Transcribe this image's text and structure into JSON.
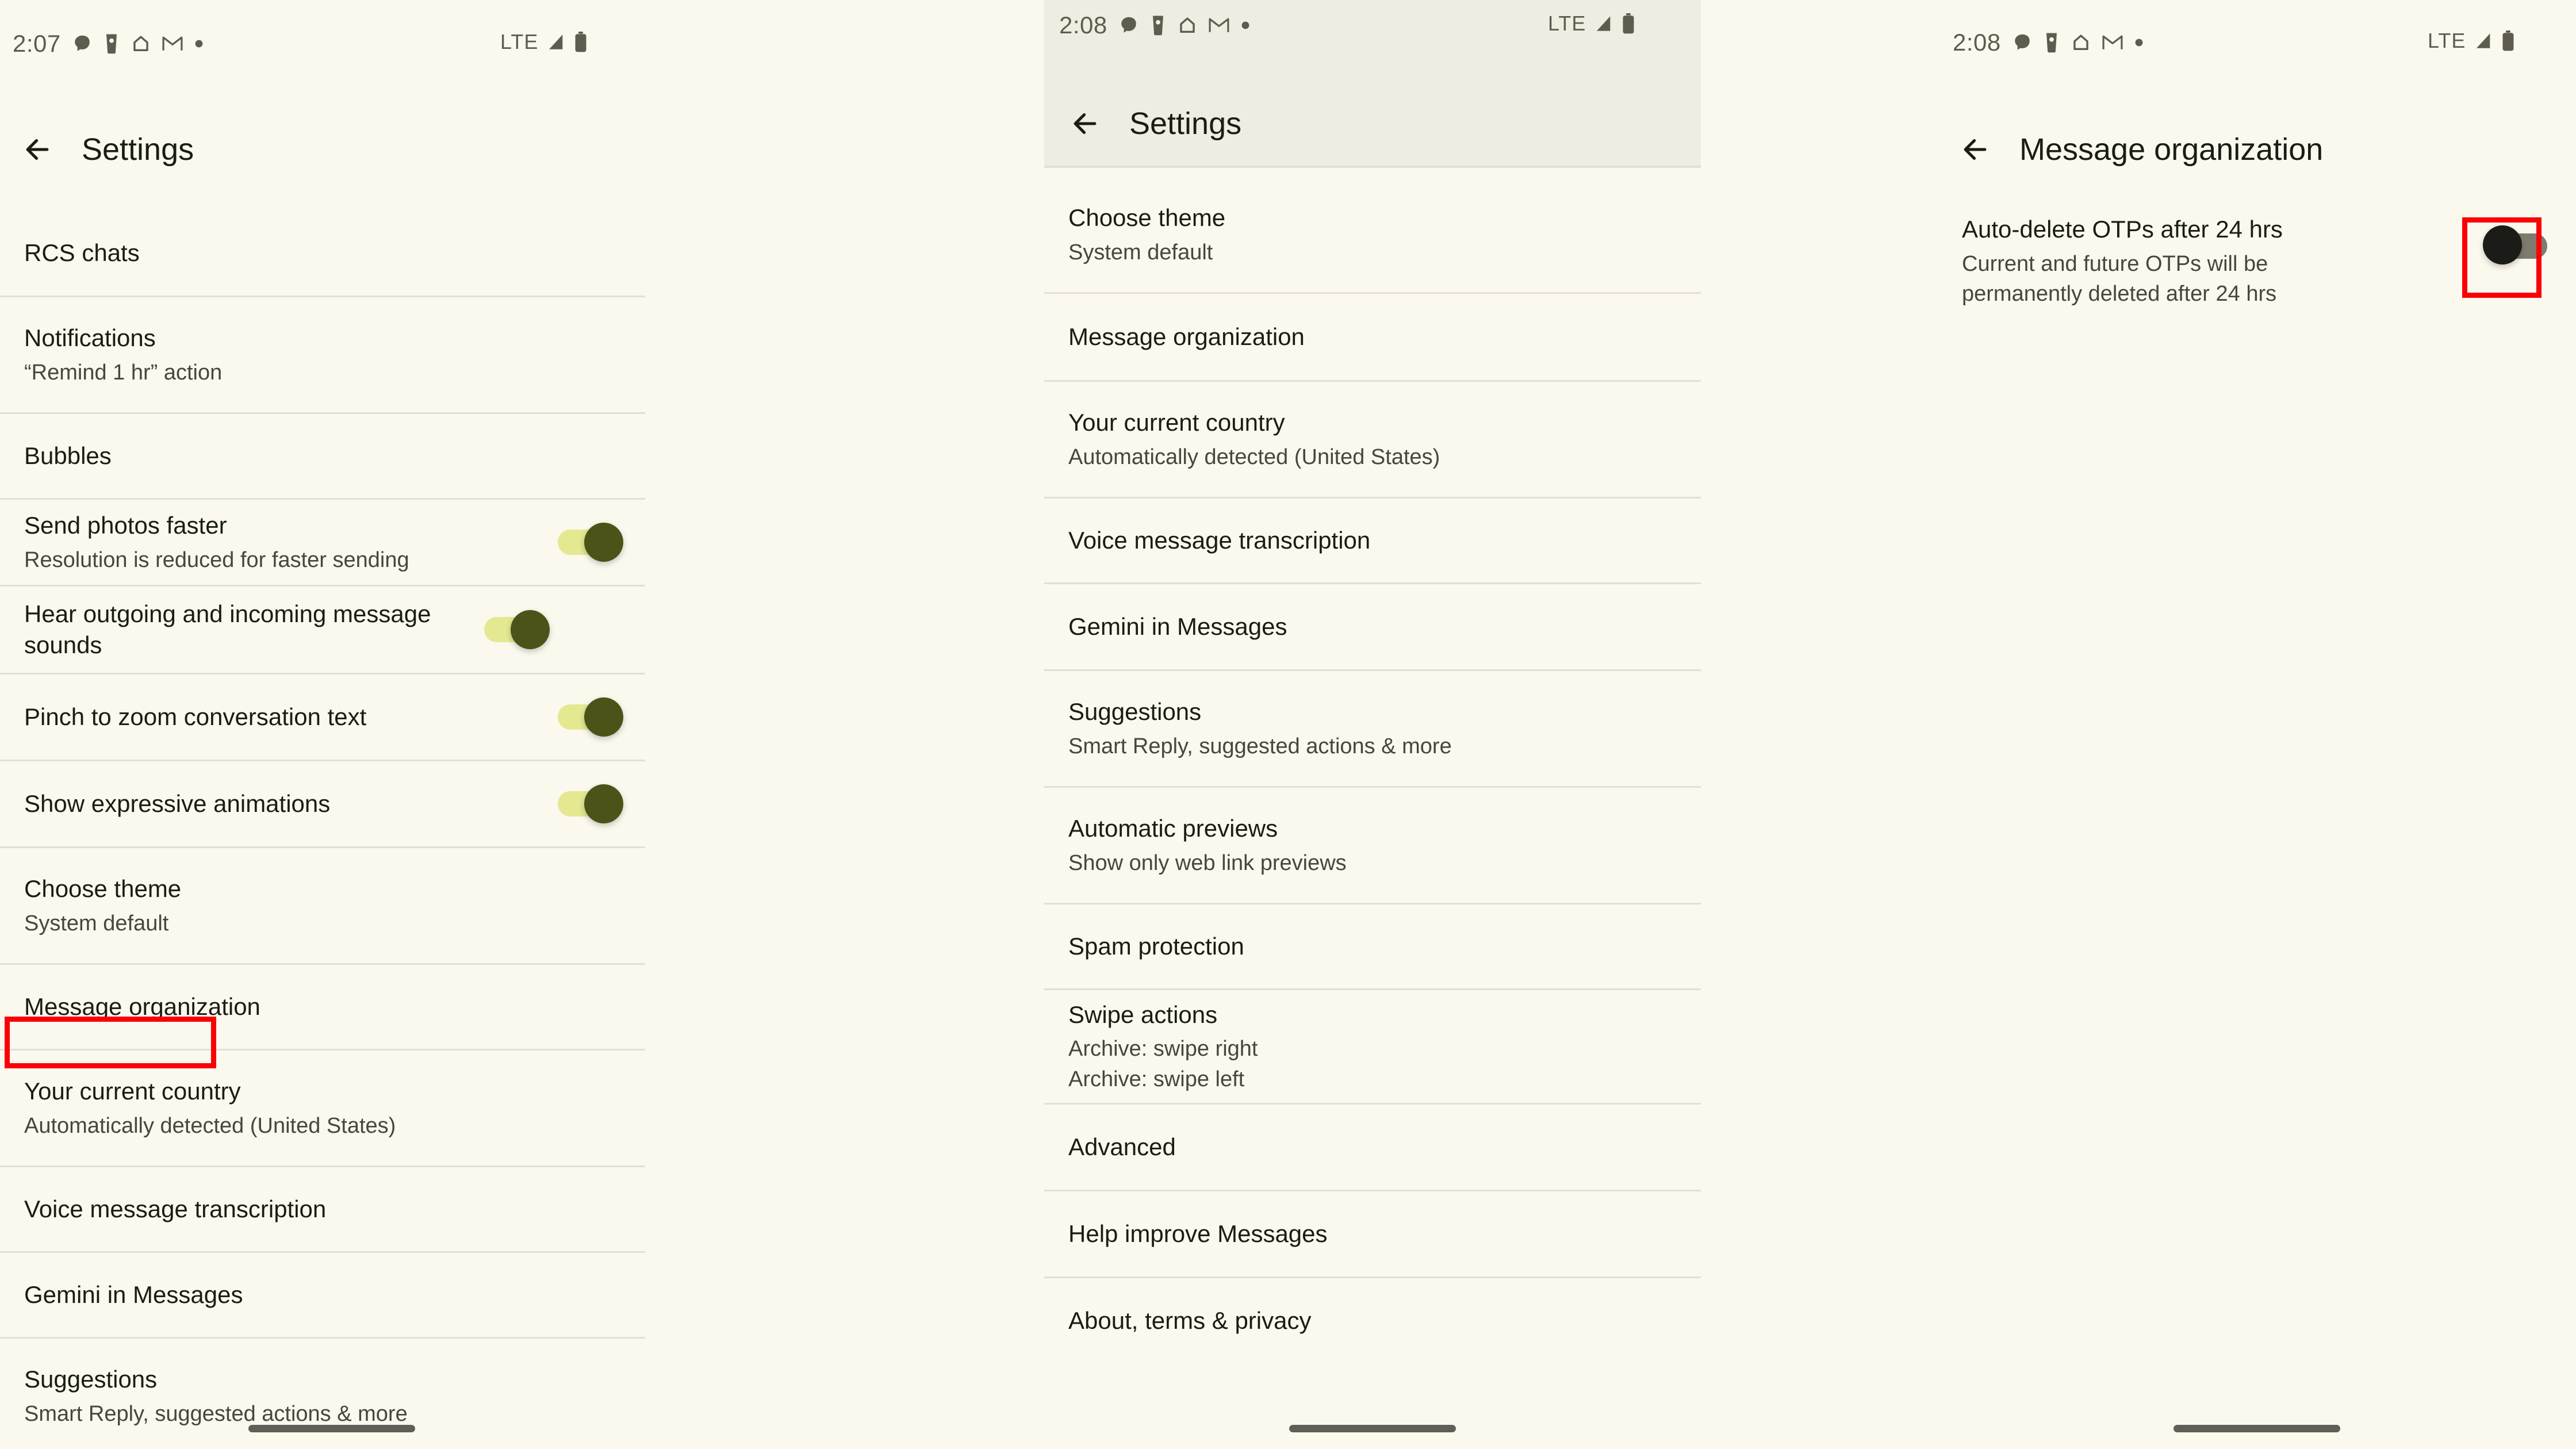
{
  "colors": {
    "background": "#FBF8EE",
    "scrolled_header": "#EFEDE1",
    "divider": "#E2E0D3",
    "title_text": "#191D13",
    "sub_text": "#45483C",
    "status_text": "#5E5B4F",
    "highlight_box": "#FB0006",
    "toggle_on_track": "#E4E891",
    "toggle_on_thumb": "#4B5318",
    "toggle_off_track": "#7E7C6E",
    "toggle_off_thumb": "#1B1B17",
    "gesture_bar": "#605E57"
  },
  "panel_1": {
    "status_bar": {
      "time": "2:07",
      "network": "LTE",
      "icons": [
        "chat-bubble-icon",
        "coffee-cup-icon",
        "home-icon",
        "gmail-icon",
        "dot-icon"
      ],
      "right_icons": [
        "signal-icon",
        "battery-icon"
      ]
    },
    "app_bar": {
      "back": "back-arrow-icon",
      "title": "Settings"
    },
    "rows": [
      {
        "title": "RCS chats",
        "sub": "",
        "toggle": null
      },
      {
        "title": "Notifications",
        "sub": "“Remind 1 hr” action",
        "toggle": null
      },
      {
        "title": "Bubbles",
        "sub": "",
        "toggle": null
      },
      {
        "title": "Send photos faster",
        "sub": "Resolution is reduced for faster sending",
        "toggle": "on"
      },
      {
        "title": "Hear outgoing and incoming message sounds",
        "sub": "",
        "toggle": "on"
      },
      {
        "title": "Pinch to zoom conversation text",
        "sub": "",
        "toggle": "on"
      },
      {
        "title": "Show expressive animations",
        "sub": "",
        "toggle": "on"
      },
      {
        "title": "Choose theme",
        "sub": "System default",
        "toggle": null
      },
      {
        "title": "Message organization",
        "sub": "",
        "toggle": null
      },
      {
        "title": "Your current country",
        "sub": "Automatically detected (United States)",
        "toggle": null
      },
      {
        "title": "Voice message transcription",
        "sub": "",
        "toggle": null
      },
      {
        "title": "Gemini in Messages",
        "sub": "",
        "toggle": null
      },
      {
        "title": "Suggestions",
        "sub": "Smart Reply, suggested actions & more",
        "toggle": null
      }
    ],
    "highlight_target": "Message organization"
  },
  "panel_2": {
    "status_bar": {
      "time": "2:08",
      "network": "LTE",
      "icons": [
        "chat-bubble-icon",
        "coffee-cup-icon",
        "home-icon",
        "gmail-icon",
        "dot-icon"
      ],
      "right_icons": [
        "signal-icon",
        "battery-icon"
      ]
    },
    "app_bar": {
      "back": "back-arrow-icon",
      "title": "Settings"
    },
    "rows": [
      {
        "title": "Choose theme",
        "sub": "System default"
      },
      {
        "title": "Message organization",
        "sub": ""
      },
      {
        "title": "Your current country",
        "sub": "Automatically detected (United States)"
      },
      {
        "title": "Voice message transcription",
        "sub": ""
      },
      {
        "title": "Gemini in Messages",
        "sub": ""
      },
      {
        "title": "Suggestions",
        "sub": "Smart Reply, suggested actions & more"
      },
      {
        "title": "Automatic previews",
        "sub": "Show only web link previews"
      },
      {
        "title": "Spam protection",
        "sub": ""
      },
      {
        "title": "Swipe actions",
        "sub": "Archive: swipe right",
        "sub2": "Archive: swipe left"
      },
      {
        "title": "Advanced",
        "sub": ""
      },
      {
        "title": "Help improve Messages",
        "sub": ""
      },
      {
        "title": "About, terms & privacy",
        "sub": ""
      }
    ]
  },
  "panel_3": {
    "status_bar": {
      "time": "2:08",
      "network": "LTE",
      "icons": [
        "chat-bubble-icon",
        "coffee-cup-icon",
        "home-icon",
        "gmail-icon",
        "dot-icon"
      ],
      "right_icons": [
        "signal-icon",
        "battery-icon"
      ]
    },
    "app_bar": {
      "back": "back-arrow-icon",
      "title": "Message organization"
    },
    "rows": [
      {
        "title": "Auto-delete OTPs after 24 hrs",
        "sub": "Current and future OTPs will be",
        "sub2": "permanently deleted after 24 hrs",
        "toggle": "off"
      }
    ],
    "highlight_target": "auto-delete-otps-toggle"
  }
}
